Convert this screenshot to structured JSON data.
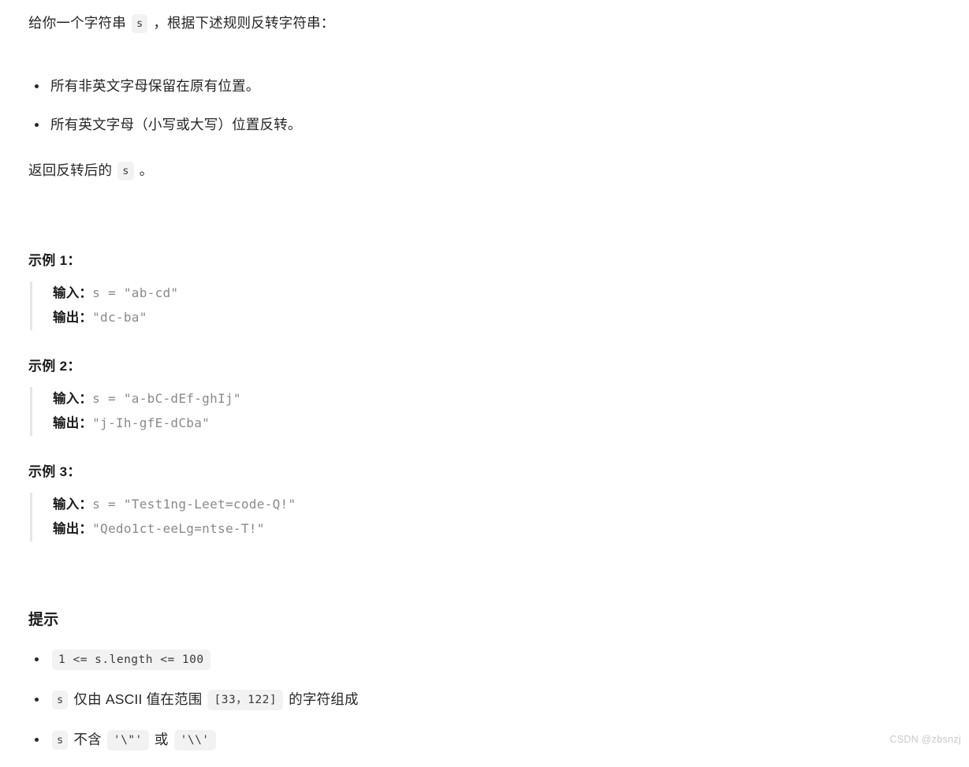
{
  "document": {
    "intro": {
      "before_code": "给你一个字符串",
      "code": "s",
      "after_code": "，根据下述规则反转字符串："
    },
    "rules": [
      "所有非英文字母保留在原有位置。",
      "所有英文字母（小写或大写）位置反转。"
    ],
    "return_statement": {
      "before_code": "返回反转后的",
      "code": "s",
      "after_code": "。"
    },
    "examples": [
      {
        "heading": "示例 1：",
        "input_label": "输入：",
        "input_code": "s = \"ab-cd\"",
        "output_label": "输出：",
        "output_code": "\"dc-ba\""
      },
      {
        "heading": "示例 2：",
        "input_label": "输入：",
        "input_code": "s = \"a-bC-dEf-ghIj\"",
        "output_label": "输出：",
        "output_code": "\"j-Ih-gfE-dCba\""
      },
      {
        "heading": "示例 3：",
        "input_label": "输入：",
        "input_code": "s = \"Test1ng-Leet=code-Q!\"",
        "output_label": "输出：",
        "output_code": "\"Qedo1ct-eeLg=ntse-T!\""
      }
    ],
    "constraints": {
      "heading": "提示",
      "items": [
        {
          "type": "code-only",
          "code": "1 <= s.length <= 100"
        },
        {
          "type": "mixed",
          "code1": "s",
          "text1": "仅由 ASCII 值在范围",
          "code2": "[33，122]",
          "text2": "的字符组成"
        },
        {
          "type": "mixed2",
          "code1": "s",
          "text1": "不含",
          "code2": "'\\\"'",
          "text2": "或",
          "code3": "'\\\\'"
        }
      ]
    },
    "watermark": "CSDN @zbsnzj"
  }
}
